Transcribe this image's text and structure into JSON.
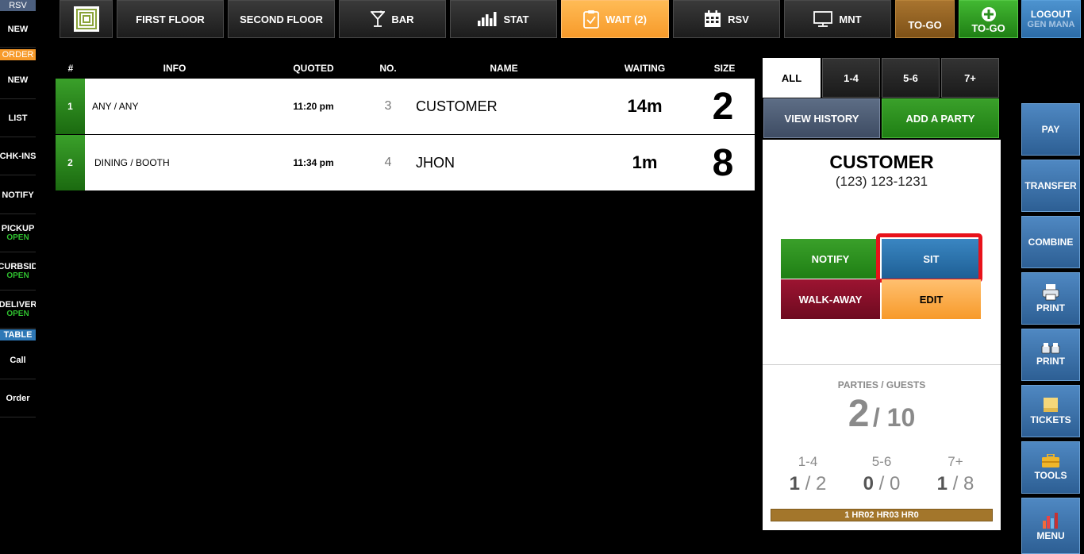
{
  "left_sidebar": {
    "tag_rsv": "RSV",
    "new_rsv": "NEW",
    "tag_order": "ORDER",
    "items": [
      {
        "label": "NEW",
        "sub": ""
      },
      {
        "label": "LIST",
        "sub": ""
      },
      {
        "label": "CHK-INS",
        "sub": ""
      },
      {
        "label": "NOTIFY",
        "sub": ""
      },
      {
        "label": "PICKUP",
        "sub": "OPEN"
      },
      {
        "label": "CURBSID",
        "sub": "OPEN"
      },
      {
        "label": "DELIVER",
        "sub": "OPEN"
      }
    ],
    "tag_table": "TABLE",
    "table_items": [
      {
        "label": "Call"
      },
      {
        "label": "Order"
      }
    ],
    "colors": {
      "rsv_tag": "#4c5f7e",
      "order_tag": "#f79a2a",
      "table_tag": "#2e78b6",
      "open": "#2fbf2f"
    }
  },
  "top_nav": {
    "first_floor": "FIRST FLOOR",
    "second_floor": "SECOND FLOOR",
    "bar": "BAR",
    "stat": "STAT",
    "wait": "WAIT (2)",
    "rsv": "RSV",
    "mnt": "MNT",
    "togo_1": "TO-GO",
    "togo_2": "TO-GO",
    "logout": "LOGOUT",
    "user": "GEN MANA",
    "icons": {
      "logo": "logo-icon",
      "bar": "cocktail-icon",
      "stat": "bar-chart-icon",
      "wait": "clipboard-icon",
      "rsv": "calendar-icon",
      "mnt": "monitor-icon",
      "togo_add": "plus-circle-icon"
    }
  },
  "waitlist": {
    "headers": {
      "num": "#",
      "info": "INFO",
      "quoted": "QUOTED",
      "no": "NO.",
      "name": "NAME",
      "waiting": "WAITING",
      "size": "SIZE"
    },
    "rows": [
      {
        "num": "1",
        "info": "ANY / ANY",
        "quoted": "11:20 pm",
        "no": "3",
        "name": "CUSTOMER",
        "waiting": "14m",
        "size": "2"
      },
      {
        "num": "2",
        "info": "DINING / BOOTH",
        "quoted": "11:34 pm",
        "no": "4",
        "name": "JHON",
        "waiting": "1m",
        "size": "8"
      }
    ]
  },
  "detail_panel": {
    "tabs": [
      "ALL",
      "1-4",
      "5-6",
      "7+"
    ],
    "view_history": "VIEW HISTORY",
    "add_party": "ADD A PARTY",
    "customer_name": "CUSTOMER",
    "customer_phone": "(123) 123-1231",
    "notify": "NOTIFY",
    "sit": "SIT",
    "walk_away": "WALK-AWAY",
    "edit": "EDIT",
    "parties_guests_label": "PARTIES / GUESTS",
    "parties": "2",
    "guests": "10",
    "splits": [
      {
        "label": "1-4",
        "parties": "1",
        "guests": "2"
      },
      {
        "label": "5-6",
        "parties": "0",
        "guests": "0"
      },
      {
        "label": "7+",
        "parties": "1",
        "guests": "8"
      }
    ],
    "timeline": "1 HR02 HR03 HR0"
  },
  "right_bar": [
    {
      "label": "PAY",
      "icon": ""
    },
    {
      "label": "TRANSFER",
      "icon": ""
    },
    {
      "label": "COMBINE",
      "icon": ""
    },
    {
      "label": "PRINT",
      "icon": "printer-icon"
    },
    {
      "label": "PRINT",
      "icon": "kitchen-printer-icon"
    },
    {
      "label": "TICKETS",
      "icon": "note-icon"
    },
    {
      "label": "TOOLS",
      "icon": "toolbox-icon"
    },
    {
      "label": "MENU",
      "icon": "menu-chart-icon"
    }
  ]
}
